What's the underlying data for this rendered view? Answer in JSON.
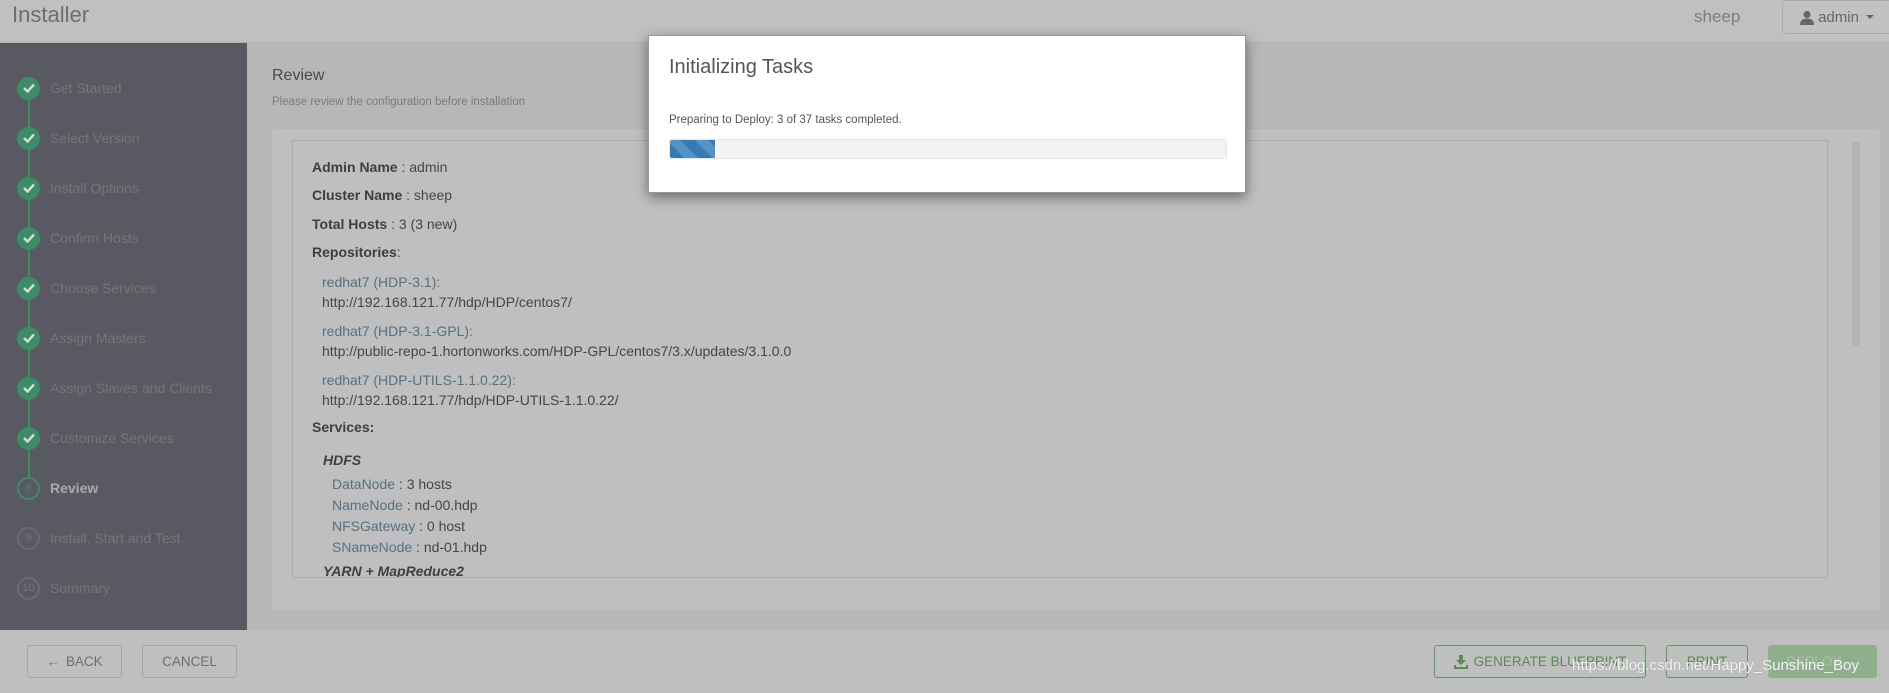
{
  "header": {
    "title": "Installer",
    "cluster": "sheep",
    "user": "admin"
  },
  "sidebar": {
    "steps": [
      {
        "label": "Get Started",
        "state": "done"
      },
      {
        "label": "Select Version",
        "state": "done"
      },
      {
        "label": "Install Options",
        "state": "done"
      },
      {
        "label": "Confirm Hosts",
        "state": "done"
      },
      {
        "label": "Choose Services",
        "state": "done"
      },
      {
        "label": "Assign Masters",
        "state": "done"
      },
      {
        "label": "Assign Slaves and Clients",
        "state": "done"
      },
      {
        "label": "Customize Services",
        "state": "done"
      },
      {
        "label": "Review",
        "state": "current",
        "num": "8"
      },
      {
        "label": "Install, Start and Test",
        "state": "todo",
        "num": "9"
      },
      {
        "label": "Summary",
        "state": "todo",
        "num": "10"
      }
    ]
  },
  "main": {
    "title": "Review",
    "subtitle": "Please review the configuration before installation",
    "admin_label": "Admin Name",
    "admin_value": " : admin",
    "cluster_label": "Cluster Name",
    "cluster_value": " : sheep",
    "hosts_label": "Total Hosts",
    "hosts_value": " : 3 (3 new)",
    "repos_label": "Repositories",
    "repos": [
      {
        "name": "redhat7 (HDP-3.1):",
        "url": "http://192.168.121.77/hdp/HDP/centos7/"
      },
      {
        "name": "redhat7 (HDP-3.1-GPL):",
        "url": "http://public-repo-1.hortonworks.com/HDP-GPL/centos7/3.x/updates/3.1.0.0"
      },
      {
        "name": "redhat7 (HDP-UTILS-1.1.0.22):",
        "url": "http://192.168.121.77/hdp/HDP-UTILS-1.1.0.22/"
      }
    ],
    "services_label": "Services:",
    "service1": "HDFS",
    "components": [
      {
        "name": "DataNode",
        "value": " : 3 hosts"
      },
      {
        "name": "NameNode",
        "value": " : nd-00.hdp"
      },
      {
        "name": "NFSGateway",
        "value": " : 0 host"
      },
      {
        "name": "SNameNode",
        "value": " : nd-01.hdp"
      }
    ],
    "service2": "YARN + MapReduce2"
  },
  "footer": {
    "back": "BACK",
    "cancel": "CANCEL",
    "blueprint": "GENERATE BLUEPRINT",
    "print": "PRINT",
    "deploy": "DEPLOY →"
  },
  "modal": {
    "title": "Initializing Tasks",
    "status": "Preparing to Deploy: 3 of 37 tasks completed.",
    "completed": 3,
    "total": 37,
    "progress_color": "#337ab7"
  },
  "watermark": "https://blog.csdn.net/Happy_Sunshine_Boy",
  "colors": {
    "sidebar": "#595a61",
    "done": "#3d8c68",
    "deploy": "#8faf8c"
  }
}
